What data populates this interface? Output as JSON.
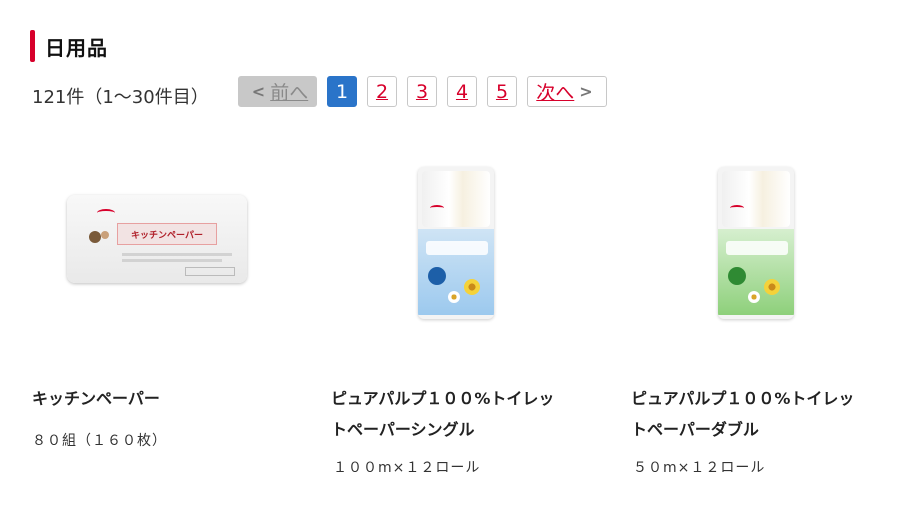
{
  "section": {
    "title": "日用品"
  },
  "results": {
    "count_text": "121件（1〜30件目）"
  },
  "pagination": {
    "prev_label": "前へ",
    "next_label": "次へ",
    "pages": [
      "1",
      "2",
      "3",
      "4",
      "5"
    ],
    "current_page": "1"
  },
  "products": [
    {
      "name": "キッチンペーパー",
      "spec": "８０組（１６０枚）",
      "image_label": "キッチンペーパー"
    },
    {
      "name_line1": "ピュアパルプ１００%トイレッ",
      "name_line2": "トペーパーシングル",
      "spec": "１００m×１２ロール"
    },
    {
      "name_line1": "ピュアパルプ１００%トイレッ",
      "name_line2": "トペーパーダブル",
      "spec": "５０m×１２ロール"
    }
  ],
  "colors": {
    "accent": "#d7002b",
    "current_page": "#2a74c9"
  }
}
